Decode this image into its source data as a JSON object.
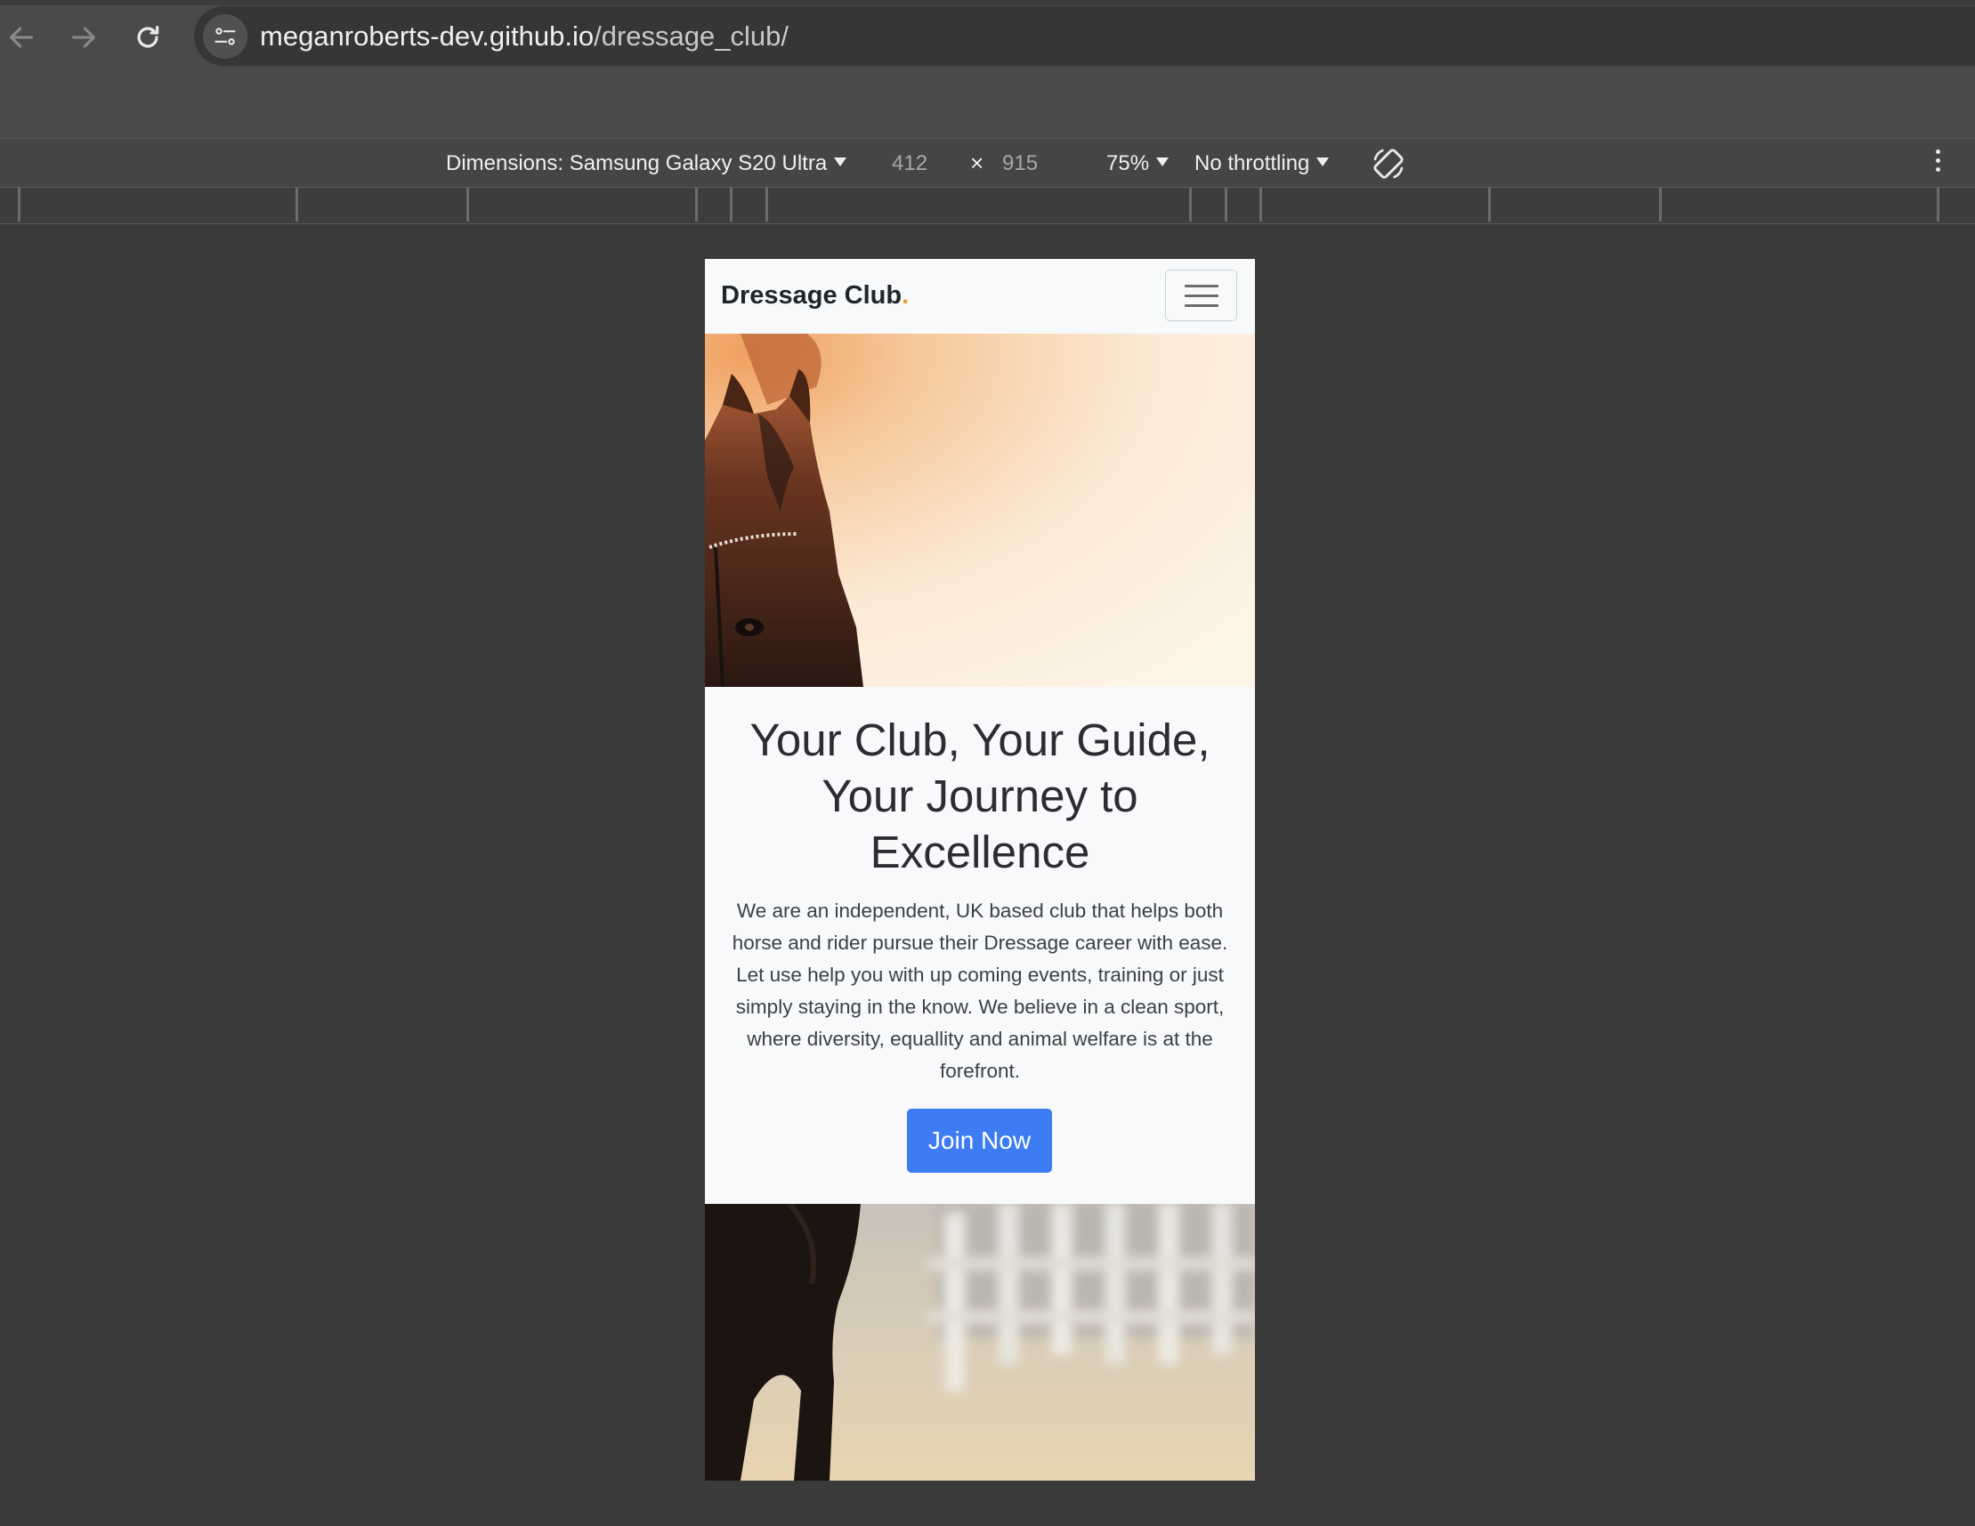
{
  "browser": {
    "url_host": "meganroberts-dev.github.io",
    "url_path": "/dressage_club/"
  },
  "devtools": {
    "dimensions_label": "Dimensions: Samsung Galaxy S20 Ultra",
    "width": "412",
    "times": "×",
    "height": "915",
    "zoom": "75%",
    "throttling": "No throttling"
  },
  "site": {
    "brand": "Dressage Club",
    "brand_dot": ".",
    "hero": {
      "headline": "Your Club, Your Guide, Your Journey to Excellence",
      "lead": "We are an independent, UK based club that helps both horse and rider pursue their Dressage career with ease. Let use help you with up coming events, training or just simply staying in the know. We believe in a clean sport, where diversity, equallity and animal welfare is at the forefront.",
      "cta": "Join Now"
    }
  },
  "colors": {
    "cta_blue": "#3d7cf2",
    "brand_dot": "#e0a030",
    "navbar_bg": "#f8f9fa"
  }
}
